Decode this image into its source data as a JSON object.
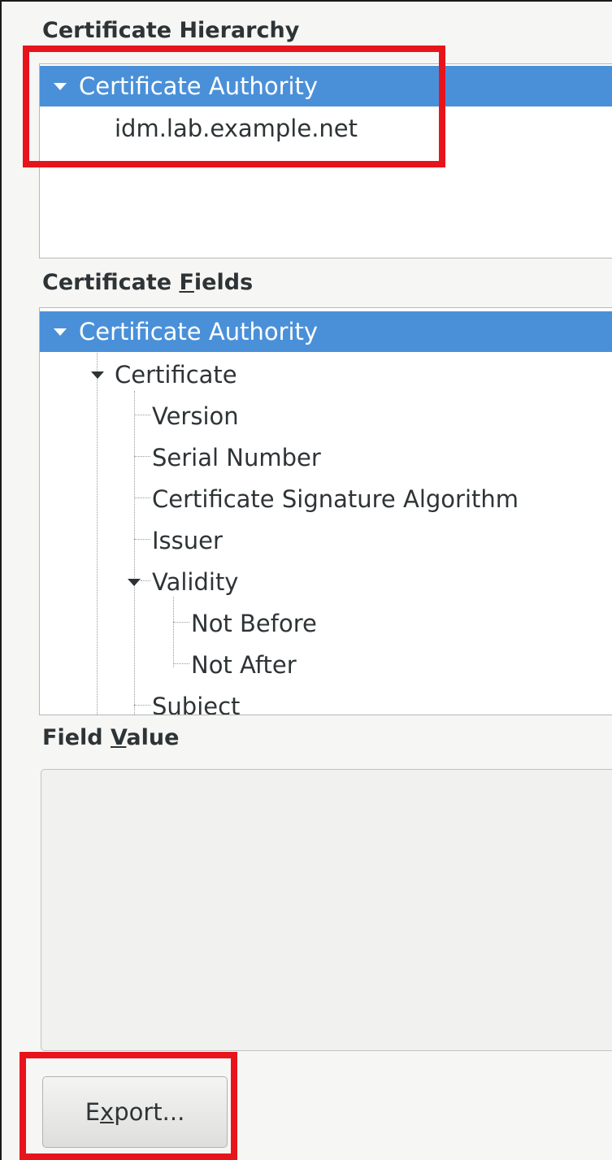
{
  "hierarchy": {
    "label": "Certificate Hierarchy",
    "items": [
      {
        "label": "Certificate Authority",
        "expanded": true,
        "selected": true
      },
      {
        "label": "idm.lab.example.net",
        "selected": false
      }
    ]
  },
  "fields": {
    "label_pre": "Certificate ",
    "label_mnemonic": "F",
    "label_post": "ields",
    "items": [
      {
        "label": "Certificate Authority",
        "expanded": true,
        "selected": true
      },
      {
        "label": "Certificate",
        "expanded": true
      },
      {
        "label": "Version"
      },
      {
        "label": "Serial Number"
      },
      {
        "label": "Certificate Signature Algorithm"
      },
      {
        "label": "Issuer"
      },
      {
        "label": "Validity",
        "expanded": true
      },
      {
        "label": "Not Before"
      },
      {
        "label": "Not After"
      },
      {
        "label": "Subject"
      }
    ]
  },
  "field_value": {
    "label_pre": "Field ",
    "label_mnemonic": "V",
    "label_post": "alue",
    "content": ""
  },
  "export_button": {
    "pre": "E",
    "mnemonic": "x",
    "post": "port..."
  },
  "colors": {
    "selection": "#4a90d9",
    "annotation": "#e8141b"
  }
}
